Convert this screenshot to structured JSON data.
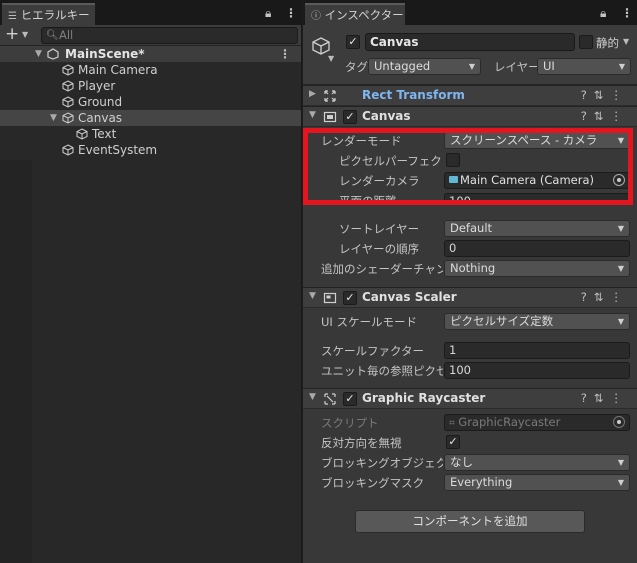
{
  "hierarchy": {
    "tab_label": "ヒエラルキー",
    "search_placeholder": "All",
    "scene": "MainScene*",
    "items": [
      "Main Camera",
      "Player",
      "Ground",
      "Canvas",
      "Text",
      "EventSystem"
    ]
  },
  "inspector": {
    "tab_label": "インスペクター",
    "object_name": "Canvas",
    "static_label": "静的",
    "tag_label": "タグ",
    "tag_value": "Untagged",
    "layer_label": "レイヤー",
    "layer_value": "UI",
    "rect_transform": {
      "title": "Rect Transform"
    },
    "canvas": {
      "title": "Canvas",
      "render_mode_label": "レンダーモード",
      "render_mode_value": "スクリーンスペース - カメラ",
      "pixel_perfect_label": "ピクセルパーフェクト",
      "render_camera_label": "レンダーカメラ",
      "render_camera_value": "Main Camera (Camera)",
      "plane_distance_label": "平面の距離",
      "plane_distance_value": "100",
      "sort_layer_label": "ソートレイヤー",
      "sort_layer_value": "Default",
      "order_label": "レイヤーの順序",
      "order_value": "0",
      "shader_channels_label": "追加のシェーダーチャンネル",
      "shader_channels_value": "Nothing"
    },
    "canvas_scaler": {
      "title": "Canvas Scaler",
      "ui_scale_mode_label": "UI スケールモード",
      "ui_scale_mode_value": "ピクセルサイズ定数",
      "scale_factor_label": "スケールファクター",
      "scale_factor_value": "1",
      "ref_ppu_label": "ユニット毎の参照ピクセル数",
      "ref_ppu_value": "100"
    },
    "graphic_raycaster": {
      "title": "Graphic Raycaster",
      "script_label": "スクリプト",
      "script_value": "GraphicRaycaster",
      "ignore_reversed_label": "反対方向を無視",
      "blocking_objects_label": "ブロッキングオブジェクト",
      "blocking_objects_value": "なし",
      "blocking_mask_label": "ブロッキングマスク",
      "blocking_mask_value": "Everything"
    },
    "add_component_label": "コンポーネントを追加"
  }
}
